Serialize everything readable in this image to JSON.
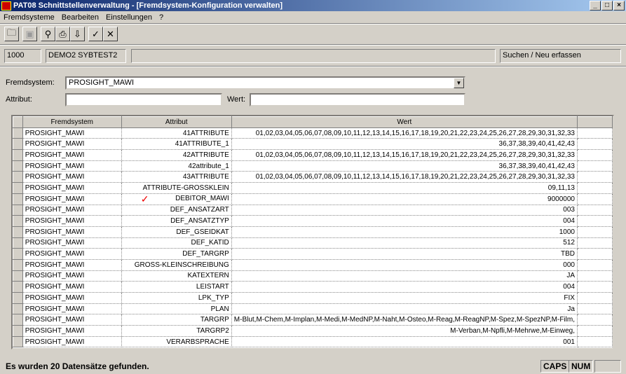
{
  "window": {
    "title": "PAT08  Schnittstellenverwaltung - [Fremdsystem-Konfiguration verwalten]"
  },
  "menu": [
    "Fremdsysteme",
    "Bearbeiten",
    "Einstellungen",
    "?"
  ],
  "info": {
    "code": "1000",
    "db": "DEMO2 SYBTEST2",
    "empty": "",
    "mode": "Suchen / Neu erfassen"
  },
  "form": {
    "fremdsystem_label": "Fremdsystem:",
    "fremdsystem_value": "PROSIGHT_MAWI",
    "attribut_label": "Attribut:",
    "attribut_value": "",
    "wert_label": "Wert:",
    "wert_value": ""
  },
  "table": {
    "headers": [
      "Fremdsystem",
      "Attribut",
      "Wert"
    ],
    "rows": [
      [
        "PROSIGHT_MAWI",
        "41ATTRIBUTE",
        "01,02,03,04,05,06,07,08,09,10,11,12,13,14,15,16,17,18,19,20,21,22,23,24,25,26,27,28,29,30,31,32,33"
      ],
      [
        "PROSIGHT_MAWI",
        "41ATTRIBUTE_1",
        "36,37,38,39,40,41,42,43"
      ],
      [
        "PROSIGHT_MAWI",
        "42ATTRIBUTE",
        "01,02,03,04,05,06,07,08,09,10,11,12,13,14,15,16,17,18,19,20,21,22,23,24,25,26,27,28,29,30,31,32,33"
      ],
      [
        "PROSIGHT_MAWI",
        "42attribute_1",
        "36,37,38,39,40,41,42,43"
      ],
      [
        "PROSIGHT_MAWI",
        "43ATTRIBUTE",
        "01,02,03,04,05,06,07,08,09,10,11,12,13,14,15,16,17,18,19,20,21,22,23,24,25,26,27,28,29,30,31,32,33"
      ],
      [
        "PROSIGHT_MAWI",
        "ATTRIBUTE-GROSSKLEIN",
        "09,11,13"
      ],
      [
        "PROSIGHT_MAWI",
        "DEBITOR_MAWI",
        "9000000"
      ],
      [
        "PROSIGHT_MAWI",
        "DEF_ANSATZART",
        "003"
      ],
      [
        "PROSIGHT_MAWI",
        "DEF_ANSATZTYP",
        "004"
      ],
      [
        "PROSIGHT_MAWI",
        "DEF_GSEIDKAT",
        "1000"
      ],
      [
        "PROSIGHT_MAWI",
        "DEF_KATID",
        "512"
      ],
      [
        "PROSIGHT_MAWI",
        "DEF_TARGRP",
        "TBD"
      ],
      [
        "PROSIGHT_MAWI",
        "GROSS-KLEINSCHREIBUNG",
        "000"
      ],
      [
        "PROSIGHT_MAWI",
        "KATEXTERN",
        "JA"
      ],
      [
        "PROSIGHT_MAWI",
        "LEISTART",
        "004"
      ],
      [
        "PROSIGHT_MAWI",
        "LPK_TYP",
        "FIX"
      ],
      [
        "PROSIGHT_MAWI",
        "PLAN",
        "Ja"
      ],
      [
        "PROSIGHT_MAWI",
        "TARGRP",
        "M-Blut,M-Chem,M-Implan,M-Medi,M-MedNP,M-Naht,M-Osteo,M-Reag,M-ReagNP,M-Spez,M-SpezNP,M-Film,"
      ],
      [
        "PROSIGHT_MAWI",
        "TARGRP2",
        "M-Verban,M-Npfli,M-Mehrwe,M-Einweg,"
      ],
      [
        "PROSIGHT_MAWI",
        "VERARBSPRACHE",
        "001"
      ]
    ]
  },
  "status": {
    "message": "Es wurden 20 Datensätze gefunden.",
    "caps": "CAPS",
    "num": "NUM"
  }
}
